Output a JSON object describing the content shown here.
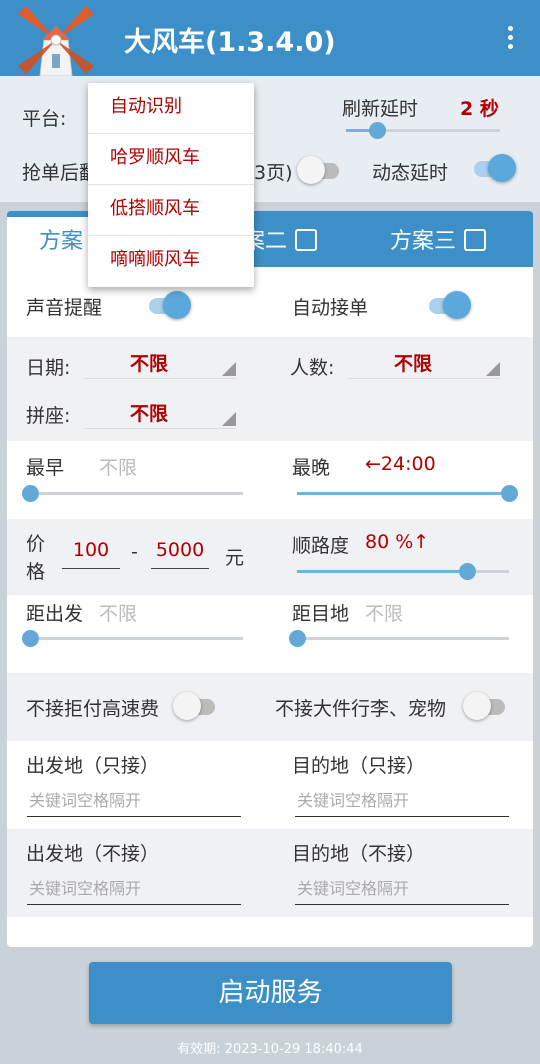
{
  "app": {
    "title": "大风车(1.3.4.0)"
  },
  "top": {
    "platform_label": "平台:",
    "refresh_label": "刷新延时",
    "refresh_value": "2 秒",
    "refresh_level": 0.2,
    "grab_label": "抢单后翻",
    "pages_label": "3页)",
    "dynamic_label": "动态延时"
  },
  "platform_menu": [
    "自动识别",
    "哈罗顺风车",
    "低搭顺风车",
    "嘀嘀顺风车"
  ],
  "tabs": [
    {
      "label": "方案"
    },
    {
      "label": "案二"
    },
    {
      "label": "方案三"
    }
  ],
  "settings": {
    "sound_label": "声音提醒",
    "auto_accept_label": "自动接单",
    "date_label": "日期:",
    "date_value": "不限",
    "people_label": "人数:",
    "people_value": "不限",
    "carpool_label": "拼座:",
    "carpool_value": "不限",
    "earliest_label": "最早",
    "earliest_value": "不限",
    "latest_label": "最晚",
    "latest_value": "←24:00",
    "price_label_1": "价",
    "price_label_2": "格",
    "price_min": "100",
    "price_dash": "-",
    "price_max": "5000",
    "price_unit": "元",
    "route_label": "顺路度",
    "route_value": "80 %↑",
    "route_level": 0.8,
    "depart_dist_label": "距出发",
    "depart_dist_value": "不限",
    "dest_dist_label": "距目地",
    "dest_dist_value": "不限",
    "no_highway_label": "不接拒付高速费",
    "no_luggage_label": "不接大件行李、宠物",
    "origin_only_label": "出发地（只接）",
    "dest_only_label": "目的地（只接）",
    "origin_exclude_label": "出发地（不接）",
    "dest_exclude_label": "目的地（不接）",
    "keyword_placeholder": "关键词空格隔开"
  },
  "start_button": "启动服务",
  "expiry": "有效期: 2023-10-29 18:40:44",
  "colors": {
    "primary": "#3d8fc8",
    "accent_red": "#b00000",
    "toggle_on": "#5aa8dc"
  }
}
